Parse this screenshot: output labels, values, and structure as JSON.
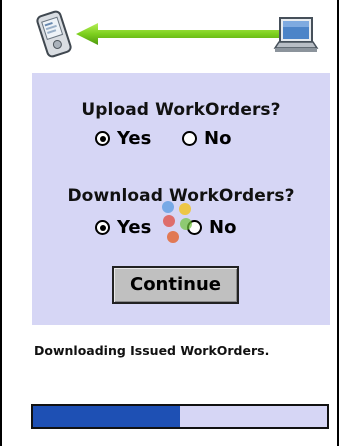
{
  "sync_header": {
    "source_icon": "handheld-device-icon",
    "target_icon": "laptop-icon",
    "arrow_icon": "sync-arrow-icon",
    "arrow_color": "#7ccf1e"
  },
  "upload": {
    "question": "Upload WorkOrders?",
    "options": [
      {
        "label": "Yes",
        "selected": true
      },
      {
        "label": "No",
        "selected": false
      }
    ]
  },
  "download": {
    "question": "Download WorkOrders?",
    "options": [
      {
        "label": "Yes",
        "selected": true
      },
      {
        "label": "No",
        "selected": false
      }
    ]
  },
  "continue_label": "Continue",
  "status": "Downloading Issued WorkOrders.",
  "progress": {
    "fraction": 0.5,
    "fill_color": "#1e50b4",
    "track_color": "#d6d6f5"
  },
  "busy_indicator_icon": "busy-spinner-icon",
  "colors": {
    "panel": "#d6d6f5",
    "button": "#c0c0c0"
  }
}
